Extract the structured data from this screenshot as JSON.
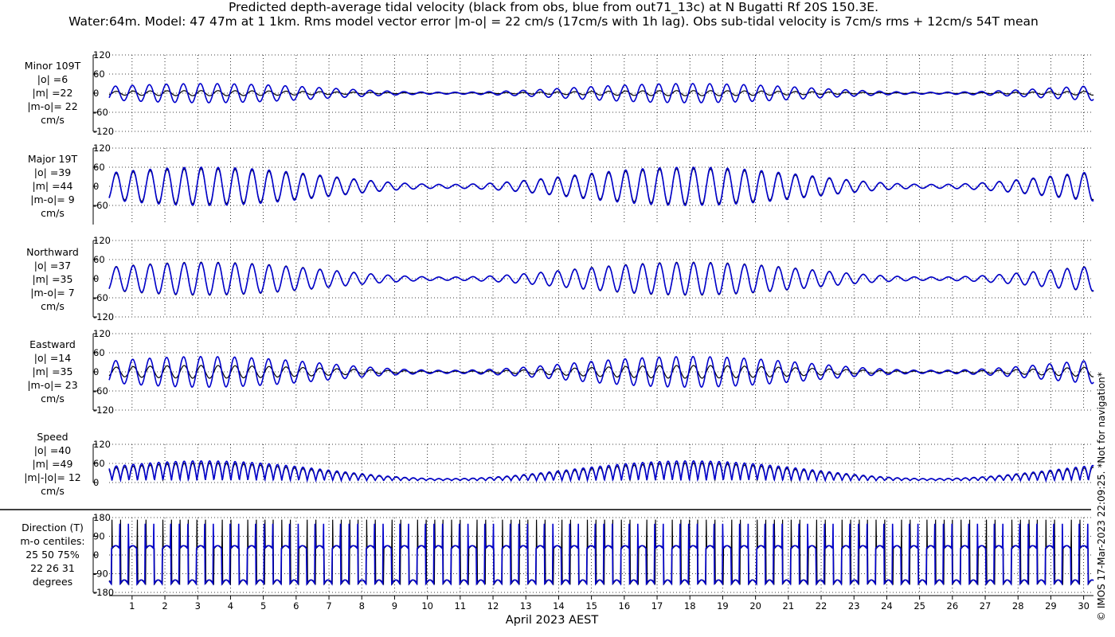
{
  "title_line1": "Predicted depth-average tidal velocity (black from obs, blue from out71_13c) at N Bugatti Rf 20S 150.3E.",
  "title_line2": "Water:64m. Model: 47 47m at 1 1km. Rms model vector error |m-o| = 22 cm/s (17cm/s with 1h lag). Obs sub-tidal velocity is 7cm/s rms + 12cm/s 54T mean",
  "copyright": "© IMOS 17-Mar-2023 22:09:25. *Not for navigation*",
  "colors": {
    "obs": "#000000",
    "model": "#0000cc"
  },
  "chart_data": {
    "type": "line",
    "xlabel": "April 2023 AEST",
    "x_ticks": [
      "1",
      "2",
      "3",
      "4",
      "5",
      "6",
      "7",
      "8",
      "9",
      "10",
      "11",
      "12",
      "13",
      "14",
      "15",
      "16",
      "17",
      "18",
      "19",
      "20",
      "21",
      "22",
      "23",
      "24",
      "25",
      "26",
      "27",
      "28",
      "29",
      "30"
    ],
    "xlim_days": [
      0.3,
      30.3
    ],
    "series_names": [
      "obs",
      "model"
    ],
    "panels": [
      {
        "id": "minor",
        "label_lines": [
          "Minor 109T",
          "|o| =6",
          "|m| =22",
          "|m-o|= 22",
          "cm/s"
        ],
        "yticks": [
          "120",
          "60",
          "0",
          "-60",
          "-120"
        ],
        "ylim": [
          -120,
          120
        ],
        "series": [
          {
            "name": "obs",
            "amplitude": 8
          },
          {
            "name": "model",
            "amplitude": 30
          }
        ]
      },
      {
        "id": "major",
        "label_lines": [
          "Major 19T",
          "|o| =39",
          "|m| =44",
          "|m-o|= 9",
          "cm/s"
        ],
        "yticks": [
          "120",
          "60",
          "0",
          "-60"
        ],
        "ylim": [
          -120,
          120
        ],
        "series": [
          {
            "name": "obs",
            "amplitude": 55
          },
          {
            "name": "model",
            "amplitude": 60
          }
        ]
      },
      {
        "id": "north",
        "label_lines": [
          "Northward",
          "|o| =37",
          "|m| =35",
          "|m-o|= 7",
          "cm/s"
        ],
        "yticks": [
          "120",
          "60",
          "0",
          "-60",
          "-120"
        ],
        "ylim": [
          -120,
          120
        ],
        "series": [
          {
            "name": "obs",
            "amplitude": 52
          },
          {
            "name": "model",
            "amplitude": 50
          }
        ]
      },
      {
        "id": "east",
        "label_lines": [
          "Eastward",
          "|o| =14",
          "|m| =35",
          "|m-o|= 23",
          "cm/s"
        ],
        "yticks": [
          "120",
          "60",
          "0",
          "-60",
          "-120"
        ],
        "ylim": [
          -120,
          120
        ],
        "series": [
          {
            "name": "obs",
            "amplitude": 20
          },
          {
            "name": "model",
            "amplitude": 48
          }
        ]
      },
      {
        "id": "speed",
        "label_lines": [
          "Speed",
          "|o| =40",
          "|m| =49",
          "|m|-|o|= 12",
          "cm/s"
        ],
        "yticks": [
          "120",
          "60",
          "0"
        ],
        "ylim": [
          0,
          120
        ],
        "series": [
          {
            "name": "obs",
            "amplitude": 55
          },
          {
            "name": "model",
            "amplitude": 62
          }
        ]
      },
      {
        "id": "direction",
        "label_lines": [
          "Direction (T)",
          "m-o centiles:",
          "25  50  75%",
          "22  26  31",
          "degrees"
        ],
        "yticks": [
          "180",
          "90",
          "0",
          "-90",
          "-180"
        ],
        "ylim": [
          -180,
          180
        ],
        "series": [
          {
            "name": "obs"
          },
          {
            "name": "model"
          }
        ]
      }
    ]
  }
}
